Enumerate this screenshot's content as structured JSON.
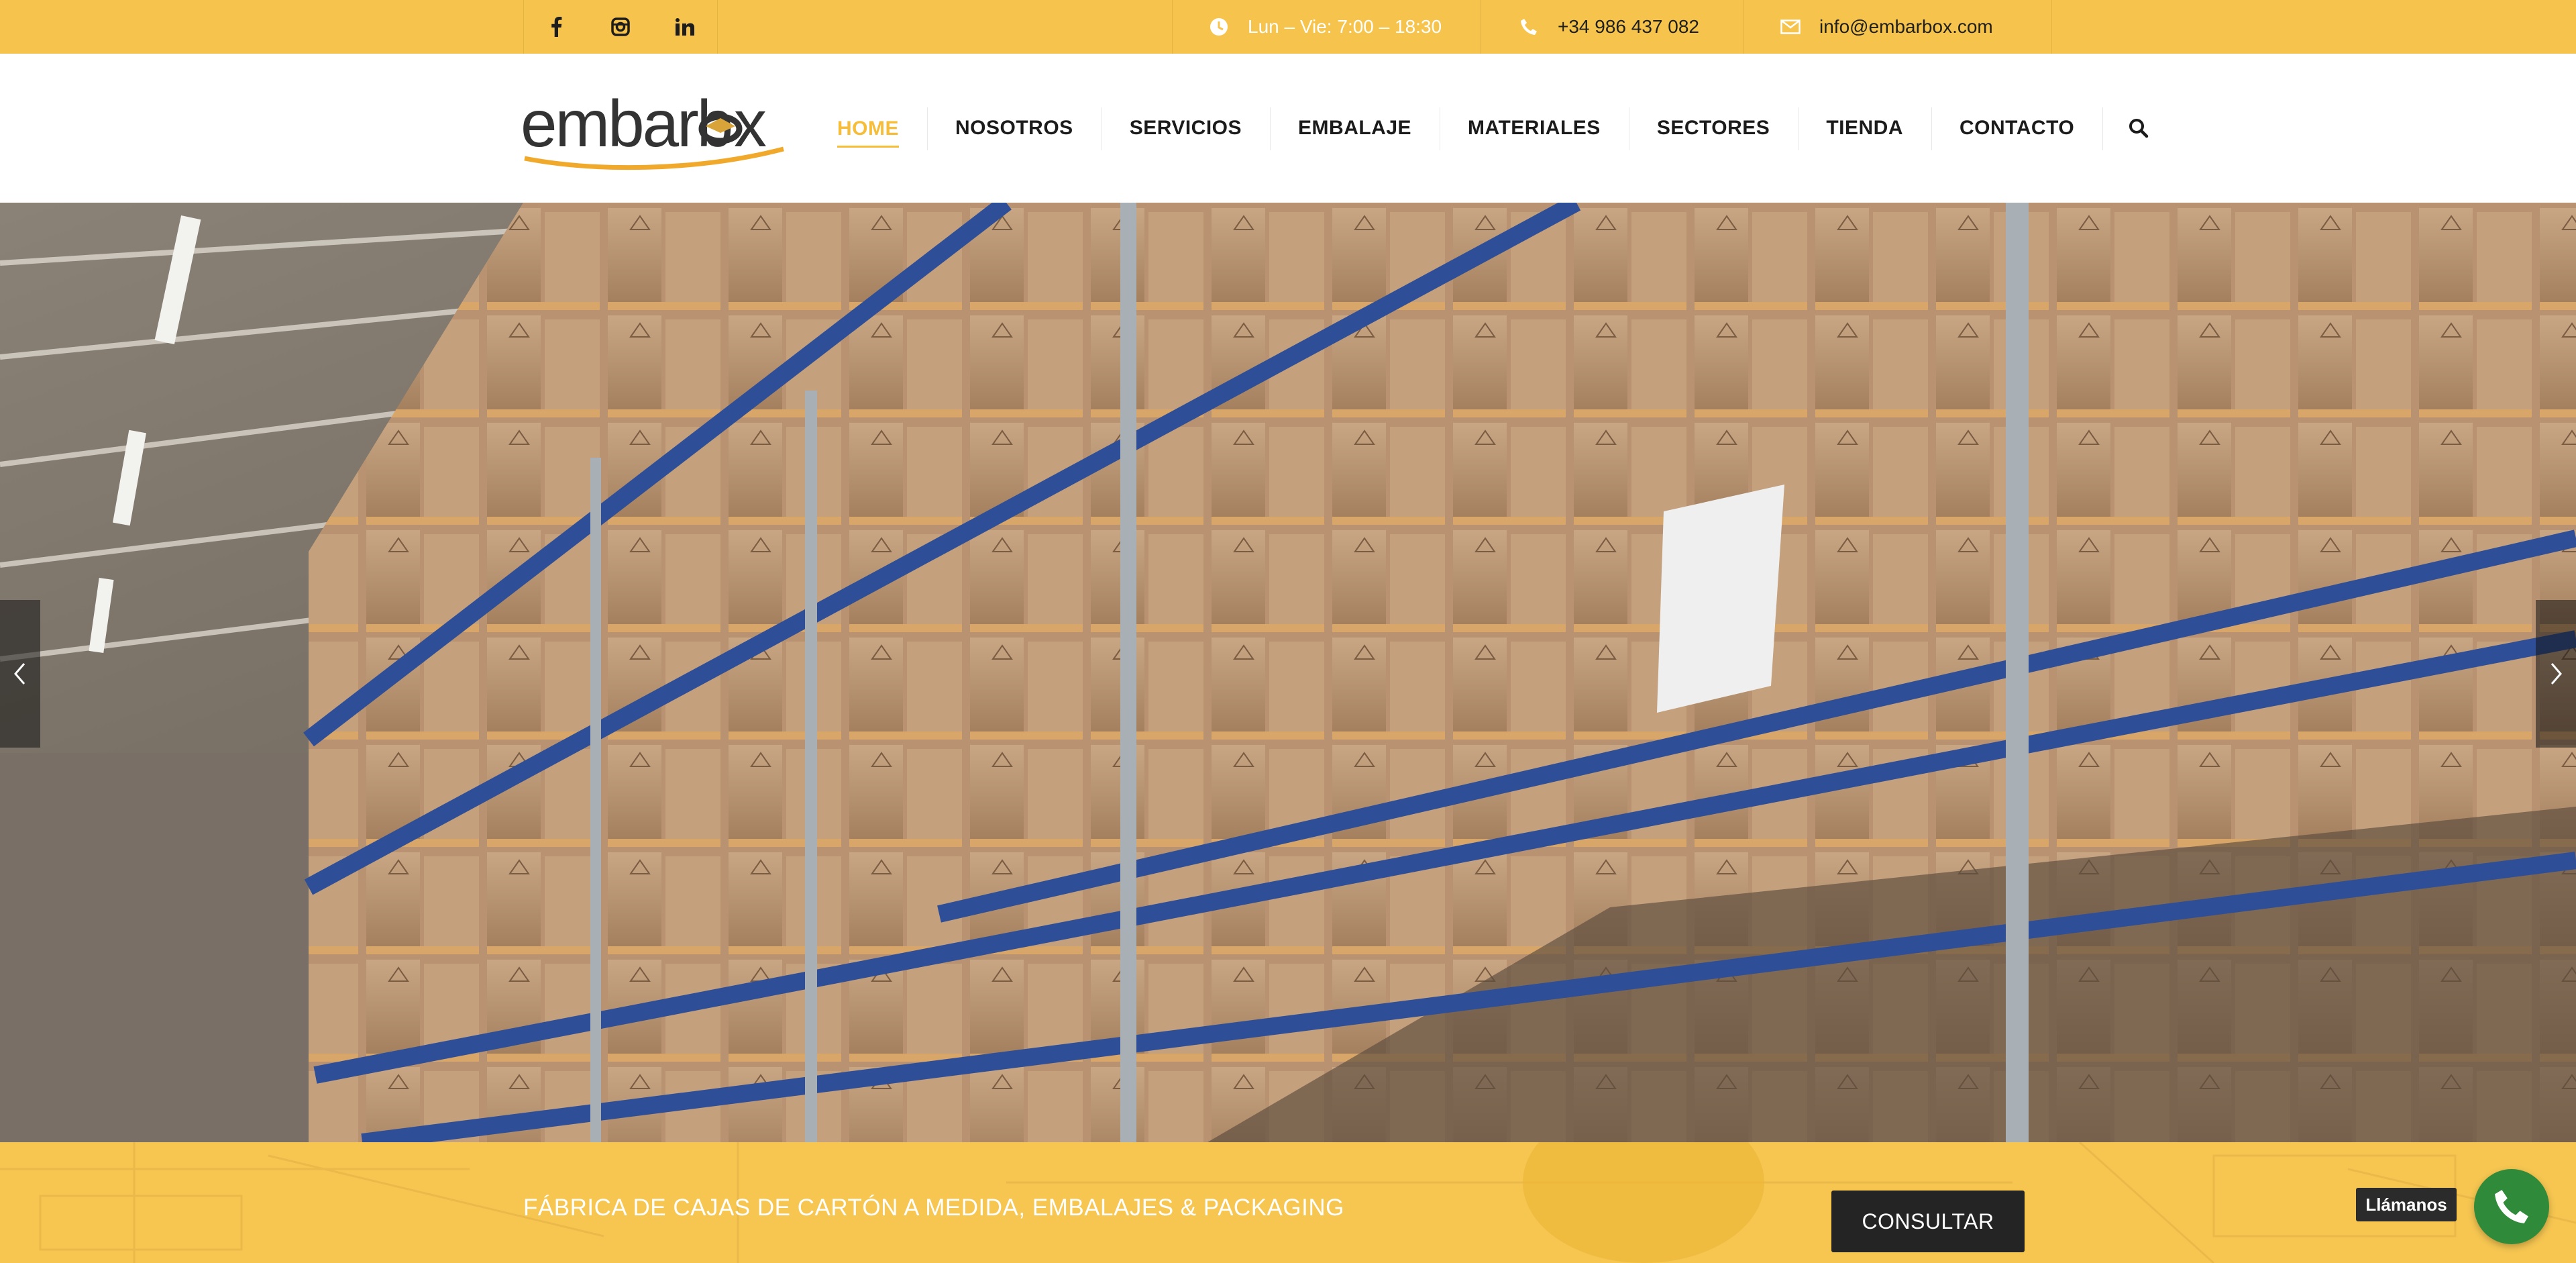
{
  "topbar": {
    "social": [
      {
        "name": "facebook-icon",
        "glyph": "f"
      },
      {
        "name": "instagram-icon",
        "glyph": ""
      },
      {
        "name": "linkedin-icon",
        "glyph": "in"
      }
    ],
    "hours": "Lun – Vie: 7:00 – 18:30",
    "phone": "+34 986 437 082",
    "email": "info@embarbox.com"
  },
  "header": {
    "logo_text": "embarbox",
    "nav": [
      {
        "label": "HOME",
        "active": true
      },
      {
        "label": "NOSOTROS"
      },
      {
        "label": "SERVICIOS"
      },
      {
        "label": "EMBALAJE"
      },
      {
        "label": "MATERIALES"
      },
      {
        "label": "SECTORES"
      },
      {
        "label": "TIENDA"
      },
      {
        "label": "CONTACTO"
      }
    ]
  },
  "banner": {
    "text": "FÁBRICA DE CAJAS DE CARTÓN A MEDIDA, EMBALAJES & PACKAGING",
    "button": "CONSULTAR"
  },
  "call": {
    "label": "Llámanos"
  },
  "colors": {
    "accent": "#f6c44c",
    "dark": "#242424",
    "call_green": "#2f8a3a"
  }
}
